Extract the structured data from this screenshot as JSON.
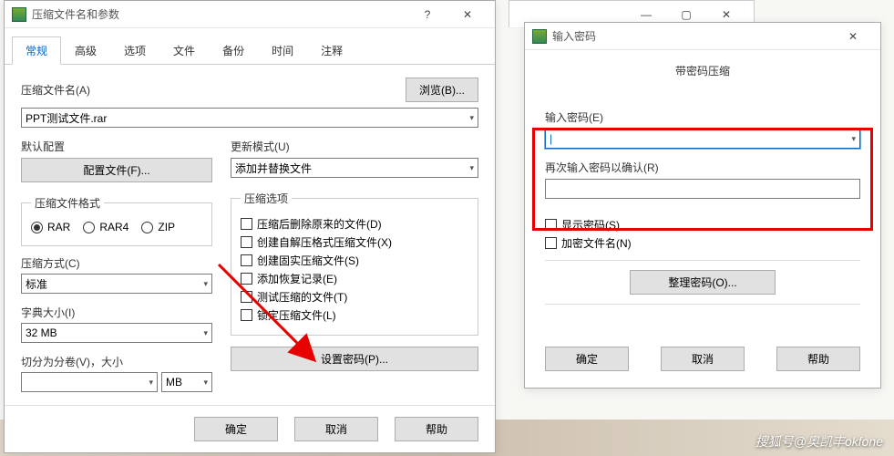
{
  "mainWindow": {
    "title": "压缩文件名和参数",
    "tabs": [
      "常规",
      "高级",
      "选项",
      "文件",
      "备份",
      "时间",
      "注释"
    ],
    "activeTab": 0,
    "archiveNameLabel": "压缩文件名(A)",
    "browseBtn": "浏览(B)...",
    "archiveName": "PPT测试文件.rar",
    "defaultProfileLabel": "默认配置",
    "configureBtn": "配置文件(F)...",
    "updateModeLabel": "更新模式(U)",
    "updateModeValue": "添加并替换文件",
    "formatLegend": "压缩文件格式",
    "formats": [
      "RAR",
      "RAR4",
      "ZIP"
    ],
    "formatSelected": 0,
    "optionsLegend": "压缩选项",
    "options": [
      "压缩后删除原来的文件(D)",
      "创建自解压格式压缩文件(X)",
      "创建固实压缩文件(S)",
      "添加恢复记录(E)",
      "测试压缩的文件(T)",
      "锁定压缩文件(L)"
    ],
    "methodLabel": "压缩方式(C)",
    "methodValue": "标准",
    "dictLabel": "字典大小(I)",
    "dictValue": "32 MB",
    "splitLabel": "切分为分卷(V)，大小",
    "splitValue": "",
    "splitUnit": "MB",
    "setPasswordBtn": "设置密码(P)...",
    "ok": "确定",
    "cancel": "取消",
    "help": "帮助"
  },
  "pwDialog": {
    "title": "输入密码",
    "subtitle": "带密码压缩",
    "enterLabel": "输入密码(E)",
    "confirmLabel": "再次输入密码以确认(R)",
    "showPassword": "显示密码(S)",
    "encryptNames": "加密文件名(N)",
    "organizeBtn": "整理密码(O)...",
    "ok": "确定",
    "cancel": "取消",
    "help": "帮助"
  },
  "watermark": "搜狐号@奥凯丰okfone"
}
